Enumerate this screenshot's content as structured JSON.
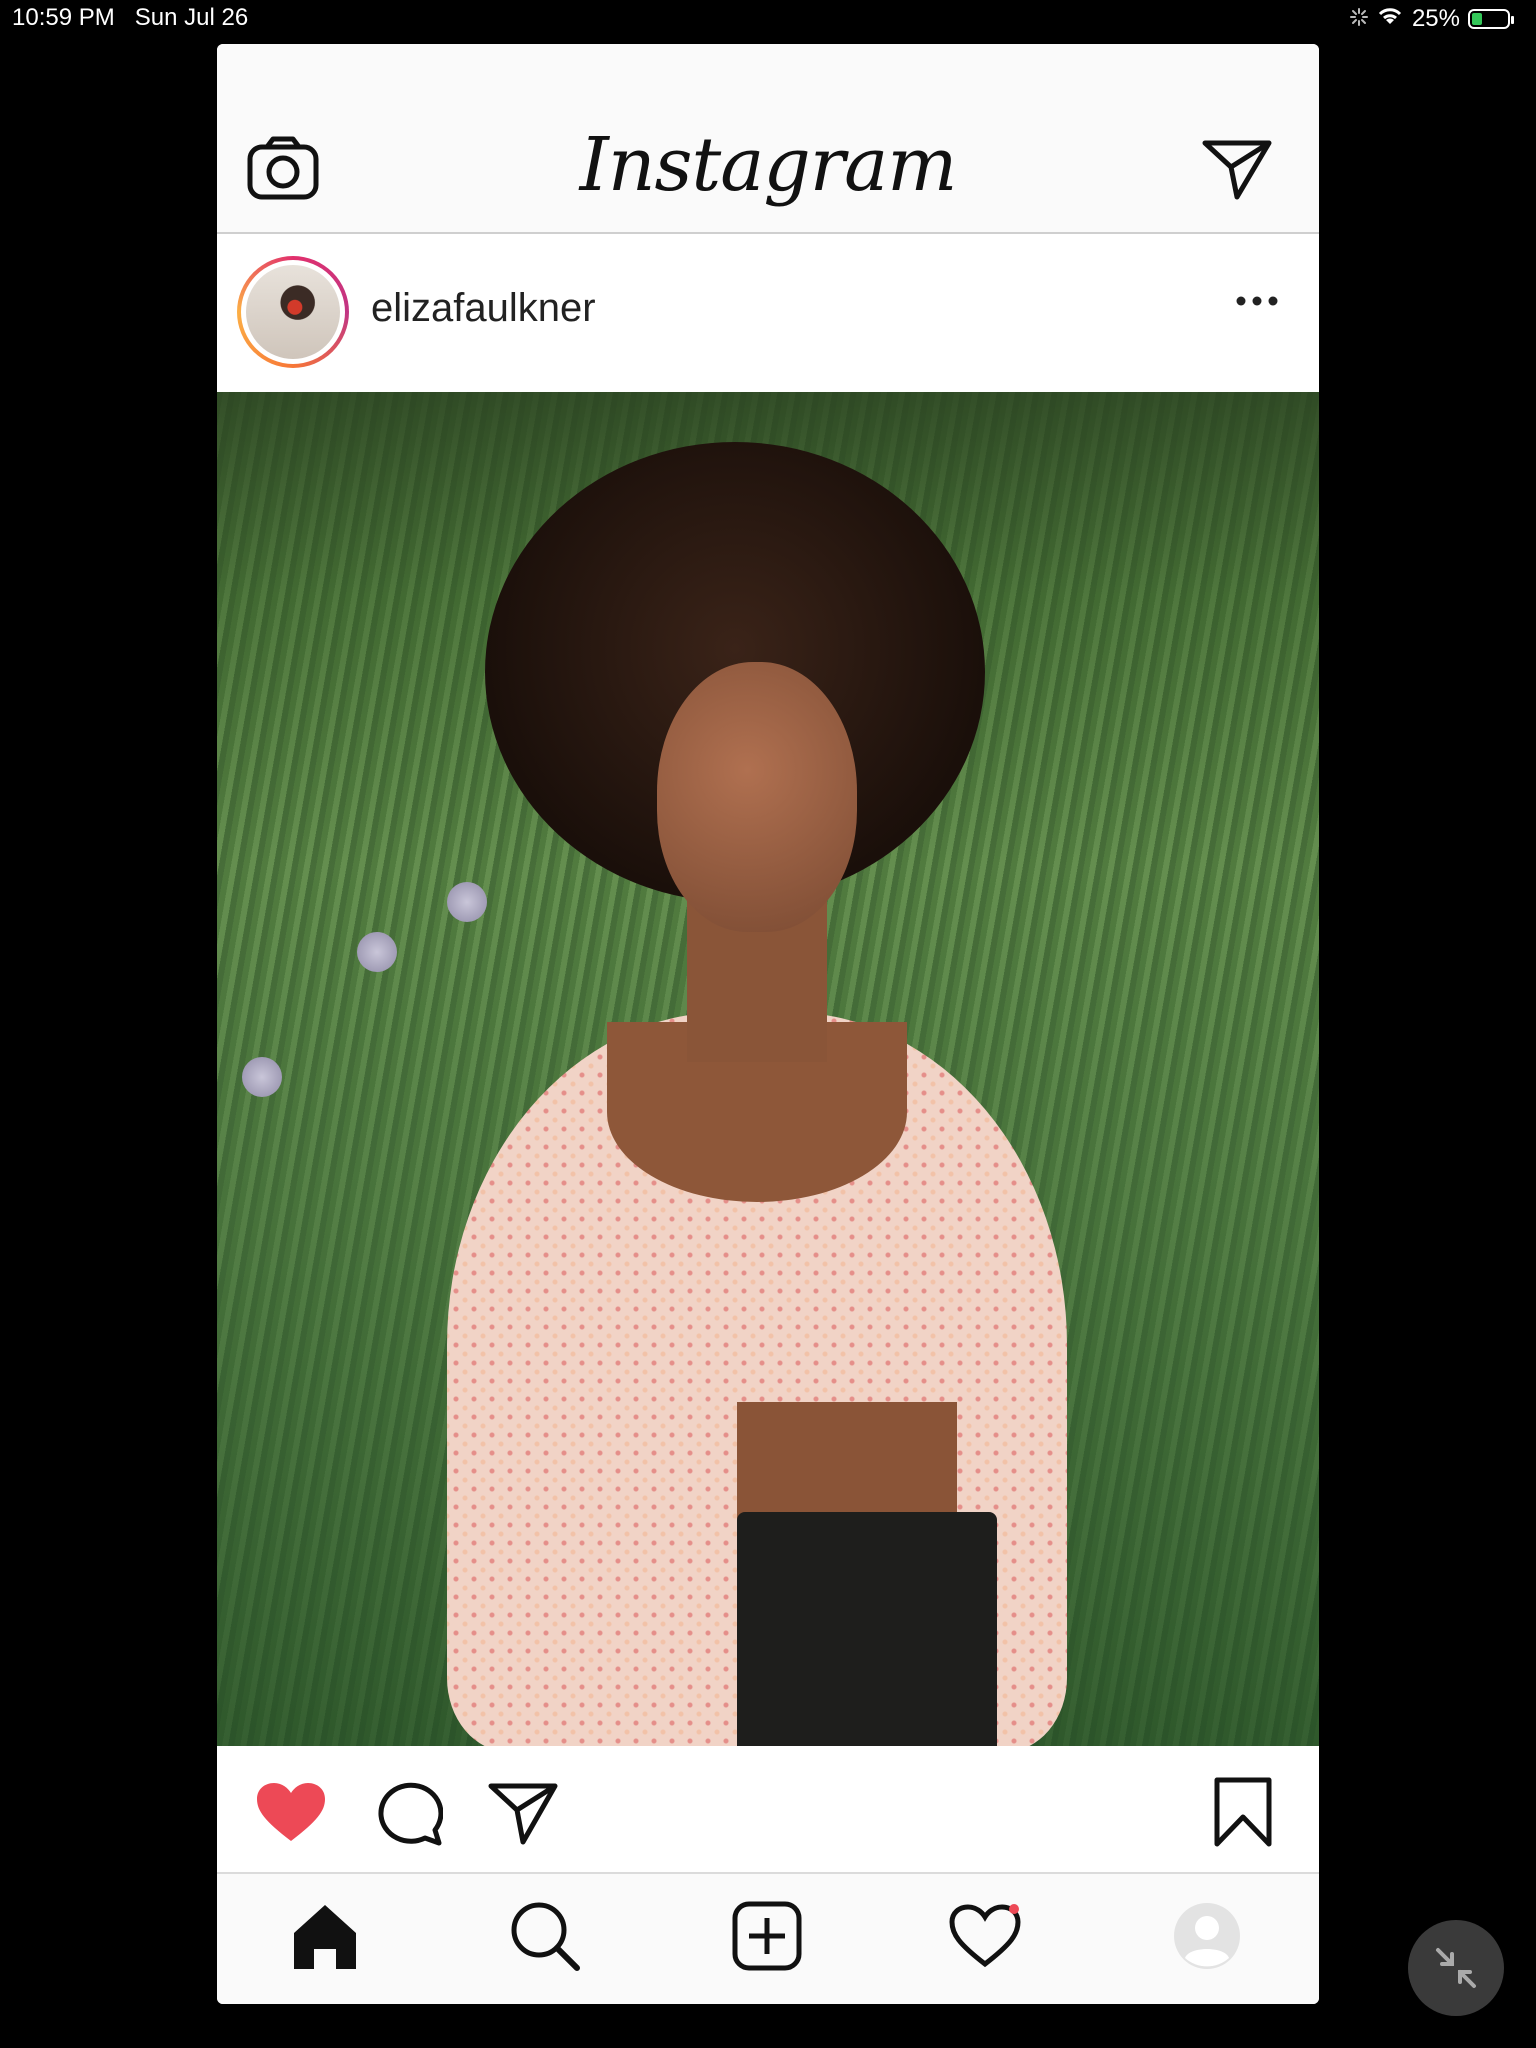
{
  "status_bar": {
    "time": "10:59 PM",
    "date": "Sun Jul 26",
    "battery": "25%",
    "battery_level": 0.25,
    "battery_color": "#34c759"
  },
  "header": {
    "title": "Instagram",
    "left_icon": "camera-icon",
    "right_icon": "direct-message-icon"
  },
  "post": {
    "username": "elizafaulkner",
    "liked": true,
    "like_color": "#ed4956",
    "options_icon": "more-options-icon"
  },
  "actions": {
    "icons": [
      "heart-filled-icon",
      "comment-icon",
      "share-icon",
      "bookmark-icon"
    ]
  },
  "tab_bar": {
    "items": [
      "home-icon",
      "search-icon",
      "new-post-icon",
      "activity-icon",
      "profile-icon"
    ]
  },
  "colors": {
    "story_ring": [
      "#e1306c",
      "#c13584",
      "#f77737",
      "#fcaf45"
    ],
    "notification_dot": "#ed4956"
  }
}
